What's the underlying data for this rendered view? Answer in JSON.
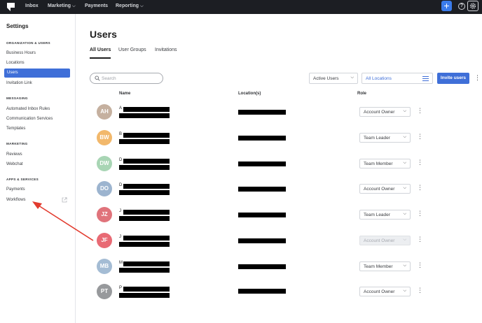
{
  "topnav": {
    "items": [
      {
        "label": "Inbox",
        "has_dropdown": false
      },
      {
        "label": "Marketing",
        "has_dropdown": true
      },
      {
        "label": "Payments",
        "has_dropdown": false
      },
      {
        "label": "Reporting",
        "has_dropdown": true
      }
    ],
    "plus_icon": "plus-icon",
    "help_icon": "help-icon",
    "gear_icon": "gear-icon",
    "accent": "#3a7bea"
  },
  "sidebar": {
    "title": "Settings",
    "sections": [
      {
        "title": "ORGANIZATION & USERS",
        "items": [
          "Business Hours",
          "Locations",
          "Users",
          "Invitation Link"
        ]
      },
      {
        "title": "MESSAGING",
        "items": [
          "Automated Inbox Rules",
          "Communication Services",
          "Templates"
        ]
      },
      {
        "title": "MARKETING",
        "items": [
          "Reviews",
          "Webchat"
        ]
      },
      {
        "title": "APPS & SERVICES",
        "items": [
          "Payments",
          "Workflows"
        ]
      }
    ],
    "active_item": "Users",
    "external_link_icon": "external-link-icon"
  },
  "main": {
    "title": "Users",
    "tabs": [
      {
        "label": "All Users",
        "active": true
      },
      {
        "label": "User Groups",
        "active": false
      },
      {
        "label": "Invitations",
        "active": false
      }
    ],
    "search": {
      "placeholder": "Search",
      "value": ""
    },
    "filter_status": "Active Users",
    "filter_location": "All Locations",
    "invite_button": "Invite users",
    "columns": {
      "name": "Name",
      "location": "Location(s)",
      "role": "Role"
    },
    "users": [
      {
        "initials": "AH",
        "name_visible": "A",
        "avatar_color": "#c5b09f",
        "role": "Account Owner",
        "role_disabled": false
      },
      {
        "initials": "BW",
        "name_visible": "B",
        "avatar_color": "#f2b86b",
        "role": "Team Leader",
        "role_disabled": false
      },
      {
        "initials": "DW",
        "name_visible": "D",
        "avatar_color": "#a8d5b4",
        "role": "Team Member",
        "role_disabled": false
      },
      {
        "initials": "DO",
        "name_visible": "D",
        "avatar_color": "#9cb4cf",
        "role": "Account Owner",
        "role_disabled": false
      },
      {
        "initials": "JZ",
        "name_visible": "J",
        "avatar_color": "#e0737b",
        "role": "Team Leader",
        "role_disabled": false
      },
      {
        "initials": "JF",
        "name_visible": "J",
        "avatar_color": "#e86a74",
        "role": "Account Owner",
        "role_disabled": true
      },
      {
        "initials": "MB",
        "name_visible": "M",
        "avatar_color": "#a4bcd4",
        "role": "Team Member",
        "role_disabled": false
      },
      {
        "initials": "PT",
        "name_visible": "P",
        "avatar_color": "#97999c",
        "role": "Account Owner",
        "role_disabled": false
      }
    ],
    "annotation_arrow_color": "#e23b2e"
  }
}
